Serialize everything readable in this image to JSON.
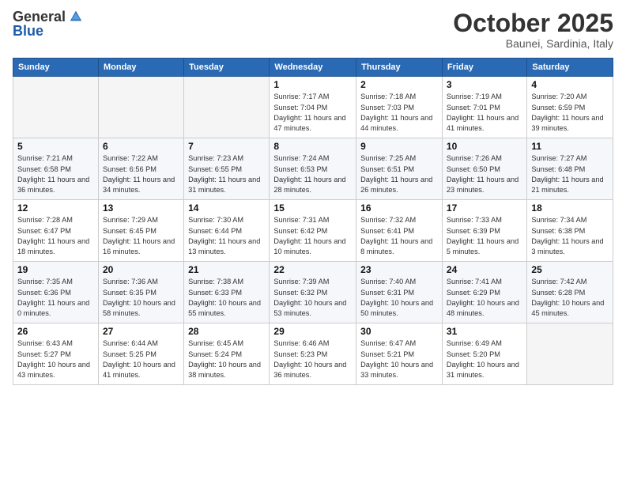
{
  "logo": {
    "text_general": "General",
    "text_blue": "Blue"
  },
  "title": "October 2025",
  "subtitle": "Baunei, Sardinia, Italy",
  "headers": [
    "Sunday",
    "Monday",
    "Tuesday",
    "Wednesday",
    "Thursday",
    "Friday",
    "Saturday"
  ],
  "weeks": [
    [
      {
        "day": "",
        "info": ""
      },
      {
        "day": "",
        "info": ""
      },
      {
        "day": "",
        "info": ""
      },
      {
        "day": "1",
        "info": "Sunrise: 7:17 AM\nSunset: 7:04 PM\nDaylight: 11 hours and 47 minutes."
      },
      {
        "day": "2",
        "info": "Sunrise: 7:18 AM\nSunset: 7:03 PM\nDaylight: 11 hours and 44 minutes."
      },
      {
        "day": "3",
        "info": "Sunrise: 7:19 AM\nSunset: 7:01 PM\nDaylight: 11 hours and 41 minutes."
      },
      {
        "day": "4",
        "info": "Sunrise: 7:20 AM\nSunset: 6:59 PM\nDaylight: 11 hours and 39 minutes."
      }
    ],
    [
      {
        "day": "5",
        "info": "Sunrise: 7:21 AM\nSunset: 6:58 PM\nDaylight: 11 hours and 36 minutes."
      },
      {
        "day": "6",
        "info": "Sunrise: 7:22 AM\nSunset: 6:56 PM\nDaylight: 11 hours and 34 minutes."
      },
      {
        "day": "7",
        "info": "Sunrise: 7:23 AM\nSunset: 6:55 PM\nDaylight: 11 hours and 31 minutes."
      },
      {
        "day": "8",
        "info": "Sunrise: 7:24 AM\nSunset: 6:53 PM\nDaylight: 11 hours and 28 minutes."
      },
      {
        "day": "9",
        "info": "Sunrise: 7:25 AM\nSunset: 6:51 PM\nDaylight: 11 hours and 26 minutes."
      },
      {
        "day": "10",
        "info": "Sunrise: 7:26 AM\nSunset: 6:50 PM\nDaylight: 11 hours and 23 minutes."
      },
      {
        "day": "11",
        "info": "Sunrise: 7:27 AM\nSunset: 6:48 PM\nDaylight: 11 hours and 21 minutes."
      }
    ],
    [
      {
        "day": "12",
        "info": "Sunrise: 7:28 AM\nSunset: 6:47 PM\nDaylight: 11 hours and 18 minutes."
      },
      {
        "day": "13",
        "info": "Sunrise: 7:29 AM\nSunset: 6:45 PM\nDaylight: 11 hours and 16 minutes."
      },
      {
        "day": "14",
        "info": "Sunrise: 7:30 AM\nSunset: 6:44 PM\nDaylight: 11 hours and 13 minutes."
      },
      {
        "day": "15",
        "info": "Sunrise: 7:31 AM\nSunset: 6:42 PM\nDaylight: 11 hours and 10 minutes."
      },
      {
        "day": "16",
        "info": "Sunrise: 7:32 AM\nSunset: 6:41 PM\nDaylight: 11 hours and 8 minutes."
      },
      {
        "day": "17",
        "info": "Sunrise: 7:33 AM\nSunset: 6:39 PM\nDaylight: 11 hours and 5 minutes."
      },
      {
        "day": "18",
        "info": "Sunrise: 7:34 AM\nSunset: 6:38 PM\nDaylight: 11 hours and 3 minutes."
      }
    ],
    [
      {
        "day": "19",
        "info": "Sunrise: 7:35 AM\nSunset: 6:36 PM\nDaylight: 11 hours and 0 minutes."
      },
      {
        "day": "20",
        "info": "Sunrise: 7:36 AM\nSunset: 6:35 PM\nDaylight: 10 hours and 58 minutes."
      },
      {
        "day": "21",
        "info": "Sunrise: 7:38 AM\nSunset: 6:33 PM\nDaylight: 10 hours and 55 minutes."
      },
      {
        "day": "22",
        "info": "Sunrise: 7:39 AM\nSunset: 6:32 PM\nDaylight: 10 hours and 53 minutes."
      },
      {
        "day": "23",
        "info": "Sunrise: 7:40 AM\nSunset: 6:31 PM\nDaylight: 10 hours and 50 minutes."
      },
      {
        "day": "24",
        "info": "Sunrise: 7:41 AM\nSunset: 6:29 PM\nDaylight: 10 hours and 48 minutes."
      },
      {
        "day": "25",
        "info": "Sunrise: 7:42 AM\nSunset: 6:28 PM\nDaylight: 10 hours and 45 minutes."
      }
    ],
    [
      {
        "day": "26",
        "info": "Sunrise: 6:43 AM\nSunset: 5:27 PM\nDaylight: 10 hours and 43 minutes."
      },
      {
        "day": "27",
        "info": "Sunrise: 6:44 AM\nSunset: 5:25 PM\nDaylight: 10 hours and 41 minutes."
      },
      {
        "day": "28",
        "info": "Sunrise: 6:45 AM\nSunset: 5:24 PM\nDaylight: 10 hours and 38 minutes."
      },
      {
        "day": "29",
        "info": "Sunrise: 6:46 AM\nSunset: 5:23 PM\nDaylight: 10 hours and 36 minutes."
      },
      {
        "day": "30",
        "info": "Sunrise: 6:47 AM\nSunset: 5:21 PM\nDaylight: 10 hours and 33 minutes."
      },
      {
        "day": "31",
        "info": "Sunrise: 6:49 AM\nSunset: 5:20 PM\nDaylight: 10 hours and 31 minutes."
      },
      {
        "day": "",
        "info": ""
      }
    ]
  ]
}
